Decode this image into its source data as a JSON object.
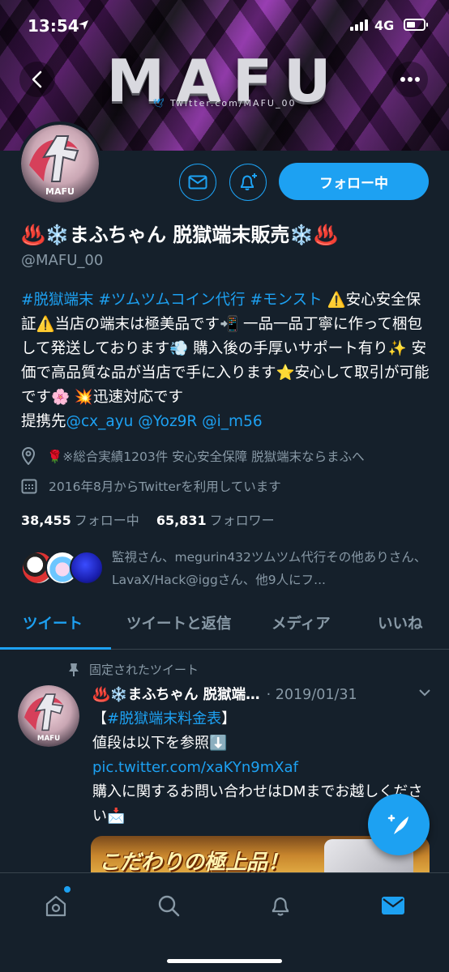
{
  "status_bar": {
    "time": "13:54",
    "network": "4G"
  },
  "banner": {
    "title": "MAFU",
    "subtitle": "Twitter.com/MAFU_00"
  },
  "profile": {
    "avatar_label": "MAFU",
    "display_name": "♨️❄️まふちゃん 脱獄端末販売❄️♨️",
    "handle": "@MAFU_00",
    "follow_button": "フォロー中",
    "bio": {
      "line1_tags": "#脱獄端末 #ツムツムコイン代行 #モンスト",
      "line1_text": "⚠️安心安全保証⚠️当店の端末は極美品です📲 一品一品丁寧に作って梱包して発送しております💨 購入後の手厚いサポート有り✨ 安価で高品質な品が当店で手に入ります⭐️安心して取引が可能です🌸 💥迅速対応です",
      "partner_label": "提携先",
      "partner_links": "@cx_ayu @Yoz9R @i_m56"
    },
    "location": "🌹※総合実績1203件 安心安全保障 脱獄端末ならまふへ",
    "joined": "2016年8月からTwitterを利用しています",
    "following_count": "38,455",
    "following_label": "フォロー中",
    "followers_count": "65,831",
    "followers_label": "フォロワー",
    "followed_by": "監視さん、megurin432ツムツム代行その他ありさん、LavaX/Hack@iggさん、他9人にフ..."
  },
  "tabs": [
    {
      "label": "ツイート",
      "active": true
    },
    {
      "label": "ツイートと返信",
      "active": false
    },
    {
      "label": "メディア",
      "active": false
    },
    {
      "label": "いいね",
      "active": false
    }
  ],
  "pinned_tweet": {
    "pinned_label": "固定されたツイート",
    "author": "♨️❄️まふちゃん 脱獄端…",
    "date": "· 2019/01/31",
    "tag": "【#脱獄端末料金表】",
    "line2": "値段は以下を参照⬇️",
    "link": "pic.twitter.com/xaKYn9mXaf",
    "line4": "購入に関するお問い合わせはDMまでお越しください📩",
    "media_text": "こだわりの極上品！"
  },
  "colors": {
    "background": "#15202b",
    "accent": "#1da1f2",
    "muted": "#8899a6",
    "divider": "#38444d"
  },
  "icons": {
    "back": "chevron-left-icon",
    "more": "more-horizontal-icon",
    "message": "mail-icon",
    "notify": "bell-plus-icon",
    "location": "location-pin-icon",
    "calendar": "calendar-icon",
    "pin": "pin-icon",
    "compose": "compose-feather-icon",
    "nav_home": "home-icon",
    "nav_search": "search-icon",
    "nav_notifications": "bell-icon",
    "nav_messages": "mail-icon"
  }
}
